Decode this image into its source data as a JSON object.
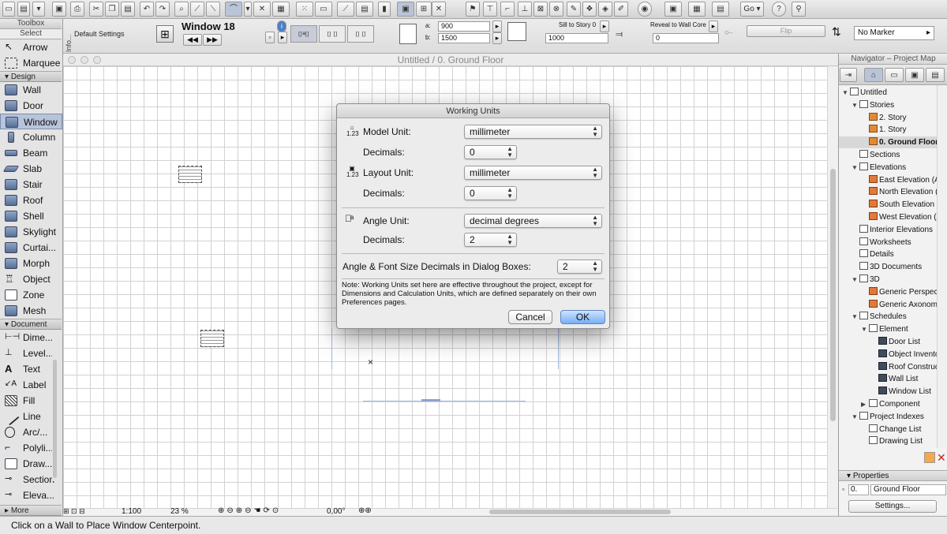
{
  "toolbar": {
    "go_label": "Go"
  },
  "infobox": {
    "default_settings": "Default Settings",
    "info_label": "Info...",
    "element_name": "Window 18",
    "a_label": "a:",
    "a_value": "900",
    "b_label": "b:",
    "b_value": "1500",
    "sill_label": "Sill to Story 0",
    "sill_value": "1000",
    "reveal_label": "Reveal to Wall Core",
    "reveal_value": "0",
    "flip_label": "Flip",
    "marker_label": "No Marker"
  },
  "toolbox": {
    "title": "Toolbox",
    "select_section": "Select",
    "select_tools": [
      "Arrow",
      "Marquee"
    ],
    "design_section": "Design",
    "design_tools": [
      "Wall",
      "Door",
      "Window",
      "Column",
      "Beam",
      "Slab",
      "Stair",
      "Roof",
      "Shell",
      "Skylight",
      "Curtai...",
      "Morph",
      "Object",
      "Zone",
      "Mesh"
    ],
    "active_tool": "Window",
    "document_section": "Document",
    "document_tools": [
      "Dime...",
      "Level...",
      "Text",
      "Label",
      "Fill",
      "Line",
      "Arc/...",
      "Polyli...",
      "Draw...",
      "Section",
      "Eleva..."
    ],
    "more": "More"
  },
  "canvas": {
    "window_title": "Untitled / 0. Ground Floor",
    "scale": "1:100",
    "zoom": "23 %",
    "angle": "0,00°"
  },
  "navigator": {
    "title": "Navigator – Project Map",
    "tree": [
      {
        "label": "Untitled",
        "level": 0,
        "icon": "project-icon",
        "expanded": true
      },
      {
        "label": "Stories",
        "level": 1,
        "icon": "stories-icon",
        "expanded": true
      },
      {
        "label": "2. Story",
        "level": 2,
        "icon": "story-icon"
      },
      {
        "label": "1. Story",
        "level": 2,
        "icon": "story-icon"
      },
      {
        "label": "0. Ground Floor",
        "level": 2,
        "icon": "story-icon",
        "selected": true
      },
      {
        "label": "Sections",
        "level": 1,
        "icon": "sections-icon"
      },
      {
        "label": "Elevations",
        "level": 1,
        "icon": "elevations-icon",
        "expanded": true
      },
      {
        "label": "East Elevation (Aut",
        "level": 2,
        "icon": "elevation-icon"
      },
      {
        "label": "North Elevation (A",
        "level": 2,
        "icon": "elevation-icon"
      },
      {
        "label": "South Elevation (A",
        "level": 2,
        "icon": "elevation-icon"
      },
      {
        "label": "West Elevation (Au",
        "level": 2,
        "icon": "elevation-icon"
      },
      {
        "label": "Interior Elevations",
        "level": 1,
        "icon": "interior-elevations-icon"
      },
      {
        "label": "Worksheets",
        "level": 1,
        "icon": "worksheets-icon"
      },
      {
        "label": "Details",
        "level": 1,
        "icon": "details-icon"
      },
      {
        "label": "3D Documents",
        "level": 1,
        "icon": "3d-documents-icon"
      },
      {
        "label": "3D",
        "level": 1,
        "icon": "3d-icon",
        "expanded": true
      },
      {
        "label": "Generic Perspectiv",
        "level": 2,
        "icon": "perspective-icon"
      },
      {
        "label": "Generic Axonomet",
        "level": 2,
        "icon": "axonometry-icon"
      },
      {
        "label": "Schedules",
        "level": 1,
        "icon": "schedules-icon",
        "expanded": true
      },
      {
        "label": "Element",
        "level": 2,
        "icon": "element-schedule-icon",
        "expanded": true
      },
      {
        "label": "Door List",
        "level": 3,
        "icon": "schedule-icon"
      },
      {
        "label": "Object Inventor",
        "level": 3,
        "icon": "schedule-icon"
      },
      {
        "label": "Roof Constructi",
        "level": 3,
        "icon": "schedule-icon"
      },
      {
        "label": "Wall List",
        "level": 3,
        "icon": "schedule-icon"
      },
      {
        "label": "Window List",
        "level": 3,
        "icon": "schedule-icon"
      },
      {
        "label": "Component",
        "level": 2,
        "icon": "component-icon",
        "expanded": false
      },
      {
        "label": "Project Indexes",
        "level": 1,
        "icon": "project-indexes-icon",
        "expanded": true
      },
      {
        "label": "Change List",
        "level": 2,
        "icon": "index-icon"
      },
      {
        "label": "Drawing List",
        "level": 2,
        "icon": "index-icon"
      }
    ],
    "properties_label": "Properties",
    "prop_number": "0.",
    "prop_name": "Ground Floor",
    "settings_button": "Settings..."
  },
  "status": {
    "message": "Click on a Wall to Place Window Centerpoint."
  },
  "dialog": {
    "title": "Working Units",
    "model_unit_label": "Model Unit:",
    "model_unit_value": "millimeter",
    "model_decimals_label": "Decimals:",
    "model_decimals_value": "0",
    "layout_unit_label": "Layout Unit:",
    "layout_unit_value": "millimeter",
    "layout_decimals_label": "Decimals:",
    "layout_decimals_value": "0",
    "angle_unit_label": "Angle Unit:",
    "angle_unit_value": "decimal degrees",
    "angle_decimals_label": "Decimals:",
    "angle_decimals_value": "2",
    "dialog_decimals_label": "Angle & Font Size Decimals in Dialog Boxes:",
    "dialog_decimals_value": "2",
    "note": "Note: Working Units set here are effective throughout the project, except for Dimensions and Calculation Units, which are defined separately on their own Preferences pages.",
    "cancel_label": "Cancel",
    "ok_label": "OK"
  },
  "colors": {
    "accent": "#78aef5",
    "selected_row": "#d8d8d8",
    "active_tool": "#b7c4da"
  }
}
